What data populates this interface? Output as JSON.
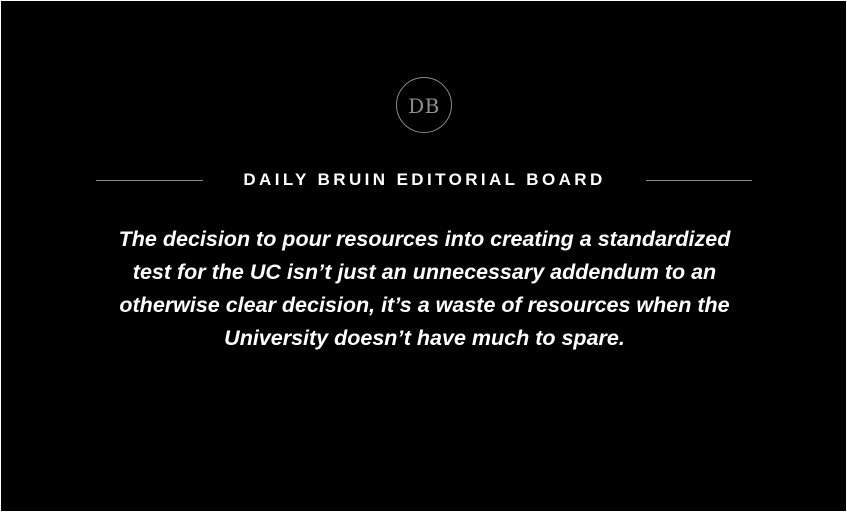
{
  "logo": {
    "text": "DB"
  },
  "header": {
    "board_name": "DAILY BRUIN EDITORIAL BOARD"
  },
  "quote": {
    "lines": [
      "The decision to pour resources into creating a standardized",
      "test for the UC isn’t just an unnecessary addendum to an",
      "otherwise clear decision, it’s a waste of resources when the",
      "University doesn’t have much to spare."
    ]
  },
  "colors": {
    "background": "#000000",
    "text": "#ffffff",
    "logo_and_rules": "#8a8a8a"
  }
}
